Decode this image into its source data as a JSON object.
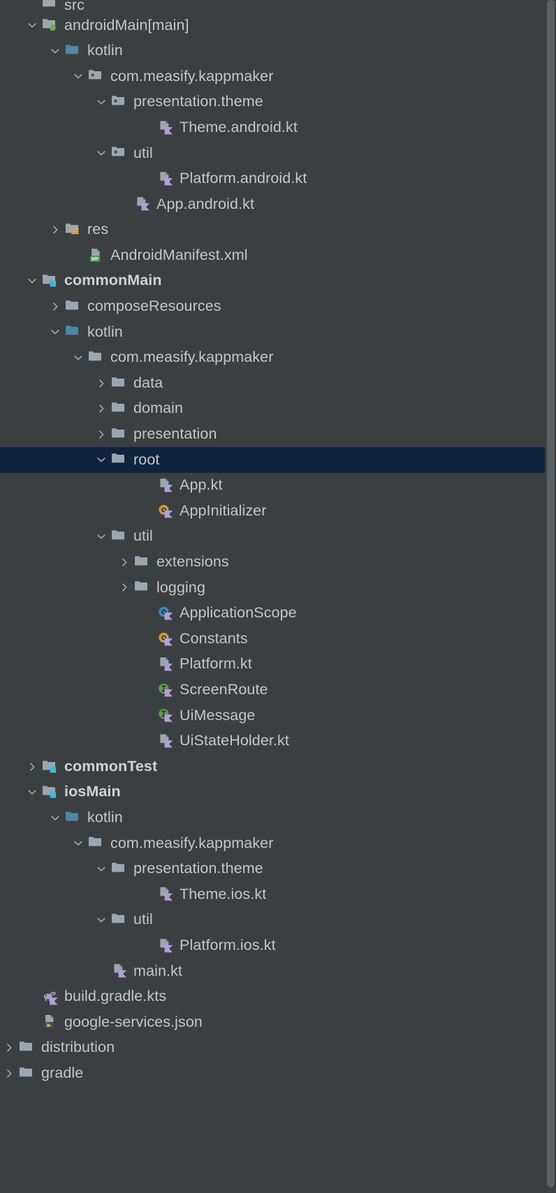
{
  "window": {
    "title": "Project Tool Window",
    "theme": "darcula",
    "background_color": "#3c3f41",
    "selection_color": "#10243e",
    "text_color": "#c3c7cb"
  },
  "scrollbar": {
    "name": "vertical-scrollbar",
    "thumb_color": "#5c6063"
  },
  "tree": {
    "rows": [
      {
        "label": "src",
        "icon": "folder-gray",
        "chevron": "none",
        "indent": 3,
        "bold": false,
        "selected": false,
        "partial": true
      },
      {
        "label": "androidMain",
        "suffix": " [main]",
        "icon": "folder-module-green",
        "chevron": "expanded",
        "indent": 3,
        "bold": false,
        "selected": false
      },
      {
        "label": "kotlin",
        "icon": "folder-source-blue",
        "chevron": "expanded",
        "indent": 4,
        "bold": false,
        "selected": false
      },
      {
        "label": "com.measify.kappmaker",
        "icon": "folder-package",
        "chevron": "expanded",
        "indent": 5,
        "bold": false,
        "selected": false
      },
      {
        "label": "presentation.theme",
        "icon": "folder-package",
        "chevron": "expanded",
        "indent": 6,
        "bold": false,
        "selected": false
      },
      {
        "label": "Theme.android.kt",
        "icon": "kotlin-file",
        "chevron": "none",
        "indent": 8,
        "bold": false,
        "selected": false
      },
      {
        "label": "util",
        "icon": "folder-package",
        "chevron": "expanded",
        "indent": 6,
        "bold": false,
        "selected": false
      },
      {
        "label": "Platform.android.kt",
        "icon": "kotlin-file",
        "chevron": "none",
        "indent": 8,
        "bold": false,
        "selected": false
      },
      {
        "label": "App.android.kt",
        "icon": "kotlin-file",
        "chevron": "none",
        "indent": 7,
        "bold": false,
        "selected": false
      },
      {
        "label": "res",
        "icon": "folder-resource",
        "chevron": "collapsed",
        "indent": 4,
        "bold": false,
        "selected": false
      },
      {
        "label": "AndroidManifest.xml",
        "icon": "manifest-file",
        "chevron": "none",
        "indent": 5,
        "bold": false,
        "selected": false
      },
      {
        "label": "commonMain",
        "icon": "folder-module-blue",
        "chevron": "expanded",
        "indent": 3,
        "bold": true,
        "selected": false
      },
      {
        "label": "composeResources",
        "icon": "folder-gray",
        "chevron": "collapsed",
        "indent": 4,
        "bold": false,
        "selected": false
      },
      {
        "label": "kotlin",
        "icon": "folder-source-blue",
        "chevron": "expanded",
        "indent": 4,
        "bold": false,
        "selected": false
      },
      {
        "label": "com.measify.kappmaker",
        "icon": "folder-gray",
        "chevron": "expanded",
        "indent": 5,
        "bold": false,
        "selected": false
      },
      {
        "label": "data",
        "icon": "folder-gray",
        "chevron": "collapsed",
        "indent": 6,
        "bold": false,
        "selected": false
      },
      {
        "label": "domain",
        "icon": "folder-gray",
        "chevron": "collapsed",
        "indent": 6,
        "bold": false,
        "selected": false
      },
      {
        "label": "presentation",
        "icon": "folder-gray",
        "chevron": "collapsed",
        "indent": 6,
        "bold": false,
        "selected": false
      },
      {
        "label": "root",
        "icon": "folder-gray",
        "chevron": "expanded",
        "indent": 6,
        "bold": false,
        "selected": true
      },
      {
        "label": "App.kt",
        "icon": "kotlin-file",
        "chevron": "none",
        "indent": 8,
        "bold": false,
        "selected": false
      },
      {
        "label": "AppInitializer",
        "icon": "kotlin-object-orange",
        "chevron": "none",
        "indent": 8,
        "bold": false,
        "selected": false
      },
      {
        "label": "util",
        "icon": "folder-gray",
        "chevron": "expanded",
        "indent": 6,
        "bold": false,
        "selected": false
      },
      {
        "label": "extensions",
        "icon": "folder-gray",
        "chevron": "collapsed",
        "indent": 7,
        "bold": false,
        "selected": false
      },
      {
        "label": "logging",
        "icon": "folder-gray",
        "chevron": "collapsed",
        "indent": 7,
        "bold": false,
        "selected": false
      },
      {
        "label": "ApplicationScope",
        "icon": "kotlin-class-blue",
        "chevron": "none",
        "indent": 8,
        "bold": false,
        "selected": false
      },
      {
        "label": "Constants",
        "icon": "kotlin-object-orange",
        "chevron": "none",
        "indent": 8,
        "bold": false,
        "selected": false
      },
      {
        "label": "Platform.kt",
        "icon": "kotlin-file",
        "chevron": "none",
        "indent": 8,
        "bold": false,
        "selected": false
      },
      {
        "label": "ScreenRoute",
        "icon": "kotlin-interface-green",
        "chevron": "none",
        "indent": 8,
        "bold": false,
        "selected": false
      },
      {
        "label": "UiMessage",
        "icon": "kotlin-interface-green",
        "chevron": "none",
        "indent": 8,
        "bold": false,
        "selected": false
      },
      {
        "label": "UiStateHolder.kt",
        "icon": "kotlin-file",
        "chevron": "none",
        "indent": 8,
        "bold": false,
        "selected": false
      },
      {
        "label": "commonTest",
        "icon": "folder-module-blue",
        "chevron": "collapsed",
        "indent": 3,
        "bold": true,
        "selected": false
      },
      {
        "label": "iosMain",
        "icon": "folder-module-blue",
        "chevron": "expanded",
        "indent": 3,
        "bold": true,
        "selected": false
      },
      {
        "label": "kotlin",
        "icon": "folder-source-blue",
        "chevron": "expanded",
        "indent": 4,
        "bold": false,
        "selected": false
      },
      {
        "label": "com.measify.kappmaker",
        "icon": "folder-gray",
        "chevron": "expanded",
        "indent": 5,
        "bold": false,
        "selected": false
      },
      {
        "label": "presentation.theme",
        "icon": "folder-gray",
        "chevron": "expanded",
        "indent": 6,
        "bold": false,
        "selected": false
      },
      {
        "label": "Theme.ios.kt",
        "icon": "kotlin-file",
        "chevron": "none",
        "indent": 8,
        "bold": false,
        "selected": false
      },
      {
        "label": "util",
        "icon": "folder-gray",
        "chevron": "expanded",
        "indent": 6,
        "bold": false,
        "selected": false
      },
      {
        "label": "Platform.ios.kt",
        "icon": "kotlin-file",
        "chevron": "none",
        "indent": 8,
        "bold": false,
        "selected": false
      },
      {
        "label": "main.kt",
        "icon": "kotlin-file",
        "chevron": "none",
        "indent": 6,
        "bold": false,
        "selected": false
      },
      {
        "label": "build.gradle.kts",
        "icon": "gradle-kts-file",
        "chevron": "none",
        "indent": 3,
        "bold": false,
        "selected": false
      },
      {
        "label": "google-services.json",
        "icon": "firebase-json-file",
        "chevron": "none",
        "indent": 3,
        "bold": false,
        "selected": false
      },
      {
        "label": "distribution",
        "icon": "folder-gray",
        "chevron": "collapsed",
        "indent": 2,
        "bold": false,
        "selected": false
      },
      {
        "label": "gradle",
        "icon": "folder-gray",
        "chevron": "collapsed",
        "indent": 2,
        "bold": false,
        "selected": false
      }
    ]
  },
  "icon_colors": {
    "folder_gray": "#9aa7b0",
    "folder_blue": "#4e87a8",
    "badge_green": "#62b543",
    "badge_blue": "#40b6e0",
    "kotlin_purple": "#b39ddb",
    "class_blue": "#3d8dae",
    "object_orange": "#c49a49",
    "interface_green": "#629755",
    "manifest_green": "#4f9c5b",
    "resource_orange": "#e8a33d"
  }
}
